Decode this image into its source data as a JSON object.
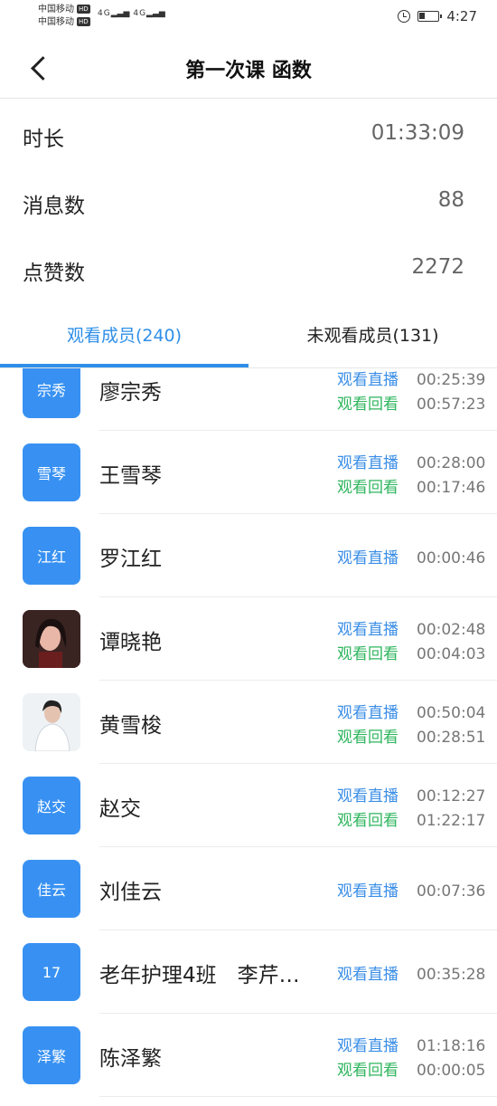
{
  "status_bar": {
    "carrier1": "中国移动",
    "carrier2": "中国移动",
    "hd": "HD",
    "net1": "4G",
    "net2": "4G",
    "time": "4:27"
  },
  "header": {
    "title": "第一次课 函数"
  },
  "stats": [
    {
      "label": "时长",
      "value": "01:33:09"
    },
    {
      "label": "消息数",
      "value": "88"
    },
    {
      "label": "点赞数",
      "value": "2272"
    }
  ],
  "tabs": [
    {
      "label": "观看成员(240)",
      "active": true
    },
    {
      "label": "未观看成员(131)",
      "active": false
    }
  ],
  "members": [
    {
      "avatar_text": "宗秀",
      "name": "廖宗秀",
      "records": [
        {
          "type": "观看直播",
          "time": "00:25:39"
        },
        {
          "type": "观看回看",
          "time": "00:57:23"
        }
      ]
    },
    {
      "avatar_text": "雪琴",
      "name": "王雪琴",
      "records": [
        {
          "type": "观看直播",
          "time": "00:28:00"
        },
        {
          "type": "观看回看",
          "time": "00:17:46"
        }
      ]
    },
    {
      "avatar_text": "江红",
      "name": "罗江红",
      "records": [
        {
          "type": "观看直播",
          "time": "00:00:46"
        }
      ]
    },
    {
      "avatar_text": "",
      "avatar_photo": true,
      "name": "谭晓艳",
      "records": [
        {
          "type": "观看直播",
          "time": "00:02:48"
        },
        {
          "type": "观看回看",
          "time": "00:04:03"
        }
      ]
    },
    {
      "avatar_text": "",
      "avatar_photo": true,
      "name": "黄雪梭",
      "records": [
        {
          "type": "观看直播",
          "time": "00:50:04"
        },
        {
          "type": "观看回看",
          "time": "00:28:51"
        }
      ]
    },
    {
      "avatar_text": "赵交",
      "name": "赵交",
      "records": [
        {
          "type": "观看直播",
          "time": "00:12:27"
        },
        {
          "type": "观看回看",
          "time": "01:22:17"
        }
      ]
    },
    {
      "avatar_text": "佳云",
      "name": "刘佳云",
      "records": [
        {
          "type": "观看直播",
          "time": "00:07:36"
        }
      ]
    },
    {
      "avatar_text": "17",
      "name": "老年护理4班　李芹…",
      "records": [
        {
          "type": "观看直播",
          "time": "00:35:28"
        }
      ]
    },
    {
      "avatar_text": "泽繁",
      "name": "陈泽繁",
      "records": [
        {
          "type": "观看直播",
          "time": "01:18:16"
        },
        {
          "type": "观看回看",
          "time": "00:00:05"
        }
      ]
    }
  ]
}
